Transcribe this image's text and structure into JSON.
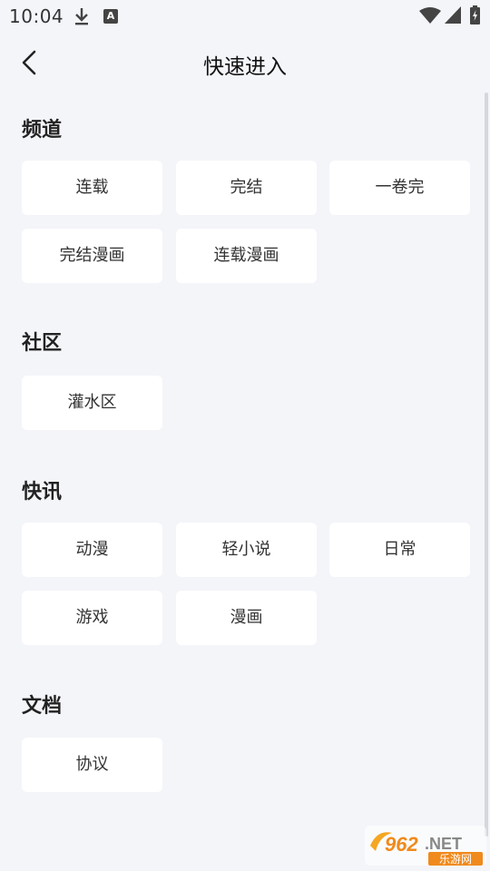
{
  "status_bar": {
    "time": "10:04"
  },
  "header": {
    "title": "快速进入"
  },
  "sections": [
    {
      "title": "频道",
      "items": [
        "连载",
        "完结",
        "一卷完",
        "完结漫画",
        "连载漫画"
      ]
    },
    {
      "title": "社区",
      "items": [
        "灌水区"
      ]
    },
    {
      "title": "快讯",
      "items": [
        "动漫",
        "轻小说",
        "日常",
        "游戏",
        "漫画"
      ]
    },
    {
      "title": "文档",
      "items": [
        "协议"
      ]
    }
  ],
  "watermark": {
    "brand": "962",
    "suffix": ".NET",
    "caption": "乐游网"
  }
}
